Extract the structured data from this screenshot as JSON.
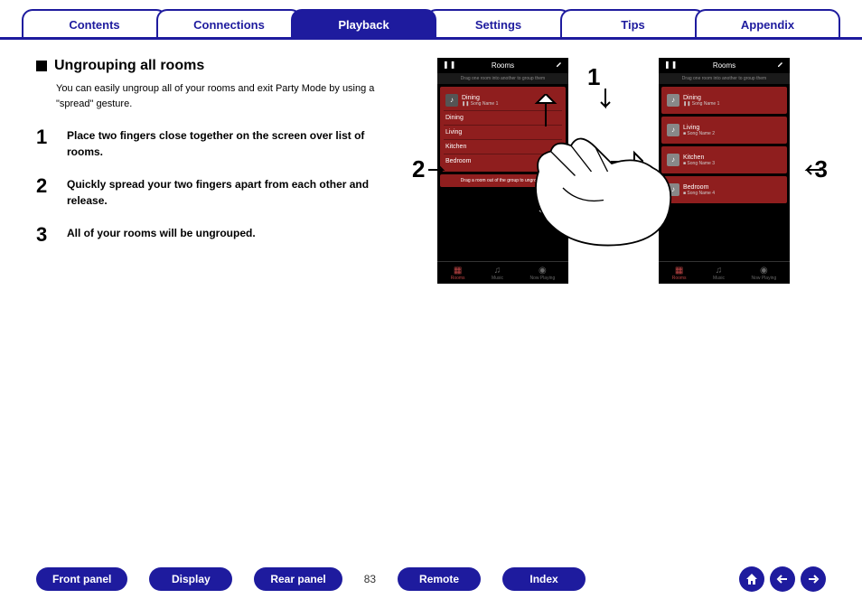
{
  "tabs": {
    "contents": "Contents",
    "connections": "Connections",
    "playback": "Playback",
    "settings": "Settings",
    "tips": "Tips",
    "appendix": "Appendix"
  },
  "section": {
    "heading": "Ungrouping all rooms",
    "intro": "You can easily ungroup all of your rooms and exit Party Mode by using a \"spread\" gesture.",
    "steps": [
      {
        "num": "1",
        "text": "Place two fingers close together on the screen over list of rooms."
      },
      {
        "num": "2",
        "text": "Quickly spread your two fingers apart from each other and release."
      },
      {
        "num": "3",
        "text": "All of your rooms will be ungrouped."
      }
    ]
  },
  "phone1": {
    "title": "Rooms",
    "sub": "Drag one room into another to group them",
    "group_master": "Dining",
    "group_song": "Song Name 1",
    "rooms": [
      "Dining",
      "Living",
      "Kitchen",
      "Bedroom"
    ],
    "drag_hint": "Drag a room out of the group to ungroup it",
    "footer": {
      "rooms": "Rooms",
      "music": "Music",
      "now": "Now Playing"
    }
  },
  "phone2": {
    "title": "Rooms",
    "sub": "Drag one room into another to group them",
    "rooms": [
      {
        "name": "Dining",
        "song": "Song Name 1"
      },
      {
        "name": "Living",
        "song": "Song Name 2"
      },
      {
        "name": "Kitchen",
        "song": "Song Name 3"
      },
      {
        "name": "Bedroom",
        "song": "Song Name 4"
      }
    ],
    "footer": {
      "rooms": "Rooms",
      "music": "Music",
      "now": "Now Playing"
    }
  },
  "callouts": {
    "n1": "1",
    "n2": "2",
    "n3": "3"
  },
  "bottom": {
    "front": "Front panel",
    "display": "Display",
    "rear": "Rear panel",
    "remote": "Remote",
    "index": "Index",
    "page": "83"
  }
}
